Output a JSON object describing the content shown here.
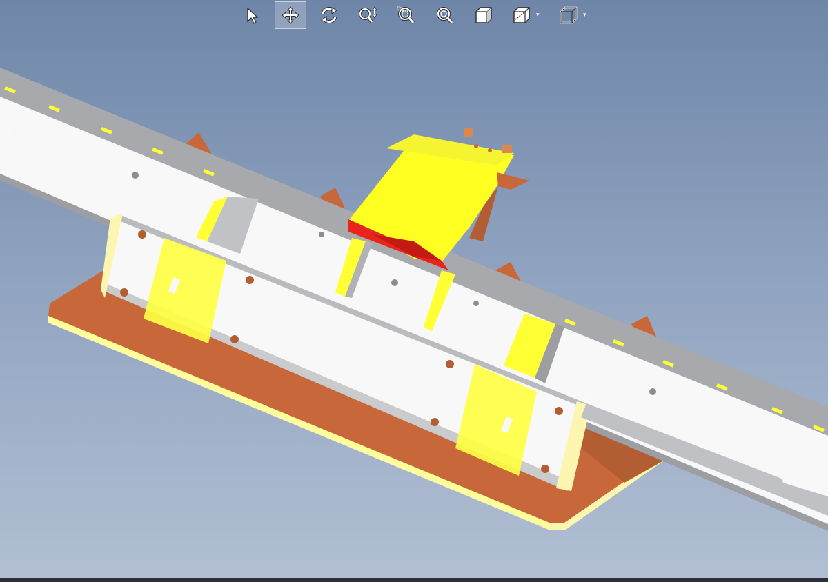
{
  "window": {
    "view": "3d-model-viewport"
  },
  "toolbar": {
    "tools": [
      {
        "name": "select",
        "icon": "cursor-arrow-icon",
        "active": false
      },
      {
        "name": "pan",
        "icon": "pan-move-icon",
        "active": true
      },
      {
        "name": "rotate",
        "icon": "rotate-icon",
        "active": false
      },
      {
        "name": "zoom",
        "icon": "zoom-updown-icon",
        "active": false
      },
      {
        "name": "zoom-window",
        "icon": "zoom-window-icon",
        "active": false
      },
      {
        "name": "zoom-fit",
        "icon": "zoom-fit-icon",
        "active": false
      },
      {
        "name": "shaded",
        "icon": "cube-shaded-icon",
        "active": false
      },
      {
        "name": "section",
        "icon": "cube-section-icon",
        "active": false,
        "has_menu": true
      },
      {
        "name": "view-orientation",
        "icon": "cube-outline-icon",
        "active": false,
        "has_menu": true
      }
    ],
    "caret_glyph": "▾"
  },
  "colors": {
    "background_top": "#6f86a8",
    "background_bottom": "#b2bfd3",
    "rail_white": "#f7f7f7",
    "rail_gray": "#a8aaad",
    "highlight_yellow": "#ffff33",
    "base_orange": "#c8683a",
    "red_part": "#e8241c"
  }
}
